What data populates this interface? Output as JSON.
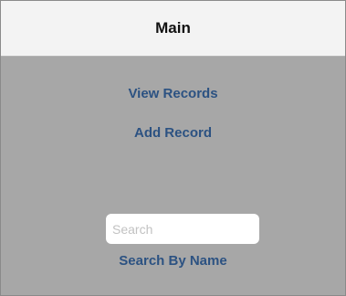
{
  "navbar": {
    "title": "Main"
  },
  "main": {
    "view_records_label": "View Records",
    "add_record_label": "Add Record",
    "search": {
      "value": "",
      "placeholder": "Search"
    },
    "search_by_name_label": "Search By Name"
  },
  "colors": {
    "link": "#2c5282",
    "background": "#a7a7a7",
    "navbar_background": "#f3f3f3"
  }
}
